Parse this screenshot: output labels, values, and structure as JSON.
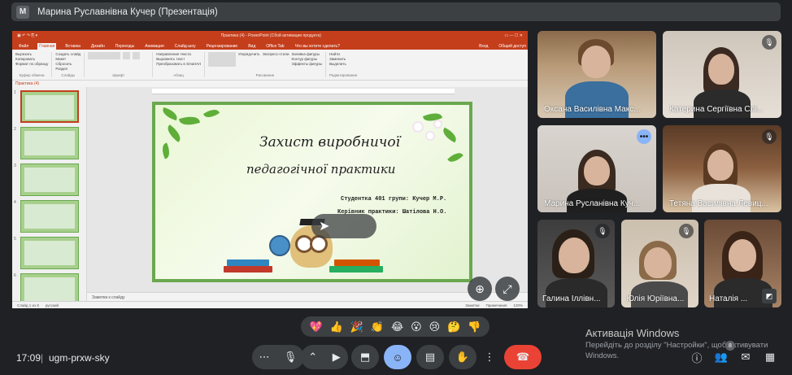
{
  "meeting": {
    "title": "Марина Руславнівна Кучер (Презентація)",
    "avatar_letter": "M",
    "time": "17:09",
    "separator": "|",
    "code": "ugm-prxw-sky"
  },
  "powerpoint": {
    "window_title": "Практика (4) - PowerPoint (Сбой активации продукта)",
    "signin": "Вход",
    "share": "Общий доступ",
    "menu": [
      "Файл",
      "Главная",
      "Вставка",
      "Дизайн",
      "Переходы",
      "Анимация",
      "Слайд-шоу",
      "Рецензирование",
      "Вид",
      "Office Tab",
      "Что вы хотите сделать?"
    ],
    "active_menu_index": 1,
    "ribbon": {
      "clipboard": {
        "items": [
          "Вырезать",
          "Копировать",
          "Формат по образцу"
        ],
        "label": "Буфер обмена"
      },
      "slides": {
        "items": [
          "Создать слайд",
          "Макет",
          "Сбросить",
          "Раздел"
        ],
        "label": "Слайды"
      },
      "font": {
        "label": "Шрифт"
      },
      "paragraph": {
        "items": [
          "Направление текста",
          "Выровнять текст",
          "Преобразовать в SmartArt"
        ],
        "label": "Абзац"
      },
      "drawing": {
        "items": [
          "Упорядочить",
          "Экспресс-стили",
          "Заливка фигуры",
          "Контур фигуры",
          "Эффекты фигуры"
        ],
        "label": "Рисование"
      },
      "editing": {
        "items": [
          "Найти",
          "Заменить",
          "Выделить"
        ],
        "label": "Редактирование"
      }
    },
    "tab_label": "Практика (4)",
    "thumb_numbers": [
      "1",
      "2",
      "3",
      "4",
      "5",
      "6"
    ],
    "notes": "Заметки к слайду",
    "status": {
      "slide": "Слайд 1 из 8",
      "lang": "русский",
      "notes_btn": "Заметки",
      "comments_btn": "Примечания",
      "zoom": "120%"
    }
  },
  "slide": {
    "title_line1": "Захист виробничої",
    "title_line2": "педагогічної практики",
    "student": "Студентка 401 групи: Кучер М.Р.",
    "supervisor": "Керівник практики: Шатілова Н.О."
  },
  "participants": [
    {
      "name": "Оксана Василівна Макс...",
      "muted": false
    },
    {
      "name": "Катерина Сергіївна Слі...",
      "muted": true
    },
    {
      "name": "Марина Русланівна Куч...",
      "muted": false,
      "active": true
    },
    {
      "name": "Тетяна Василівна Левиц...",
      "muted": true
    },
    {
      "name": "Галина Іллівн...",
      "muted": true
    },
    {
      "name": "Юлія Юріївна...",
      "muted": true
    },
    {
      "name": "Наталія ...",
      "muted": false
    }
  ],
  "reactions": [
    "💖",
    "👍",
    "🎉",
    "👏",
    "😂",
    "😮",
    "😢",
    "🤔",
    "👎"
  ],
  "windows_activation": {
    "title": "Активація Windows",
    "line1": "Перейдіть до розділу \"Настройки\", щоб активувати",
    "line2": "Windows."
  },
  "people_badge": "8",
  "colors": {
    "meet_bg": "#202124",
    "ppt_accent": "#c43e1c",
    "end_call": "#ea4335",
    "active_control": "#8ab4f8"
  }
}
